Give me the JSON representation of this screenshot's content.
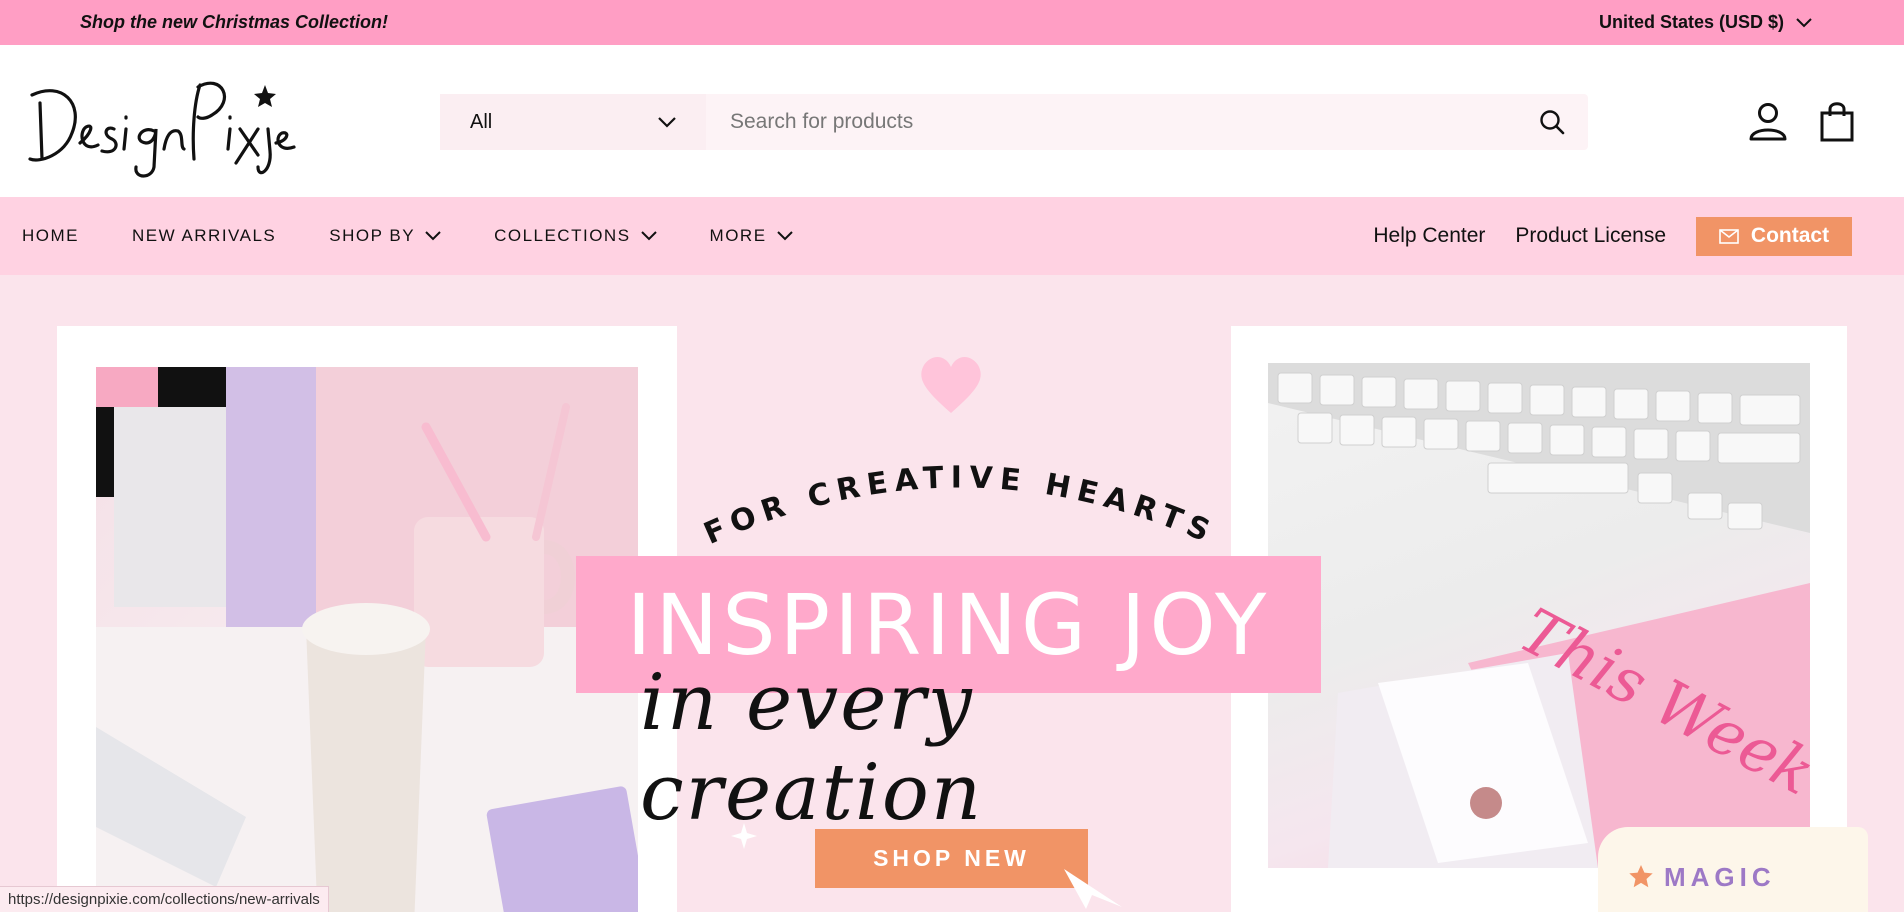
{
  "announcement": {
    "promo_text": "Shop the new Christmas Collection!",
    "region_label": "United States (USD $)"
  },
  "header": {
    "logo_text": "Design Pixie",
    "search": {
      "category_value": "All",
      "placeholder": "Search for products"
    }
  },
  "nav": {
    "items": [
      {
        "label": "HOME"
      },
      {
        "label": "NEW ARRIVALS"
      },
      {
        "label": "SHOP BY"
      },
      {
        "label": "COLLECTIONS"
      },
      {
        "label": "MORE"
      }
    ],
    "help_center": "Help Center",
    "product_license": "Product License",
    "contact": "Contact"
  },
  "hero": {
    "arc_text": "FOR CREATIVE HEARTS",
    "headline": "INSPIRING JOY",
    "script_line": "in every creation",
    "cta": "SHOP NEW",
    "photo_right_script": "This Week",
    "badge": "MAGIC"
  },
  "status_url": "https://designpixie.com/collections/new-arrivals",
  "colors": {
    "announcement_bg": "#ff9ec4",
    "nav_bg": "#ffd2e2",
    "hero_bg": "#fbe4ec",
    "accent_orange": "#f19466",
    "headline_box": "#ffa9cb"
  }
}
